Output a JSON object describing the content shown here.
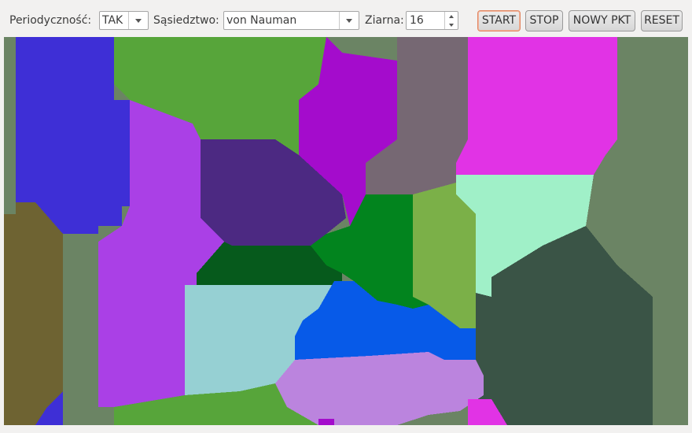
{
  "toolbar": {
    "periodicity_label": "Periodyczność:",
    "periodicity_value": "TAK",
    "neighborhood_label": "Sąsiedztwo:",
    "neighborhood_value": "von Nauman",
    "grains_label": "Ziarna:",
    "grains_value": "16",
    "start_label": "START",
    "stop_label": "STOP",
    "new_point_label": "NOWY PKT",
    "reset_label": "RESET"
  },
  "board": {
    "grain_colors": [
      "#3e2fd6",
      "#57a53a",
      "#a40ccc",
      "#766873",
      "#e133e5",
      "#6b8464",
      "#6e6332",
      "#aa40e6",
      "#4c2982",
      "#02841e",
      "#7bb048",
      "#a0f0c8",
      "#3a5446",
      "#065a1c",
      "#96d0d3",
      "#075ae8",
      "#bb84de"
    ]
  }
}
